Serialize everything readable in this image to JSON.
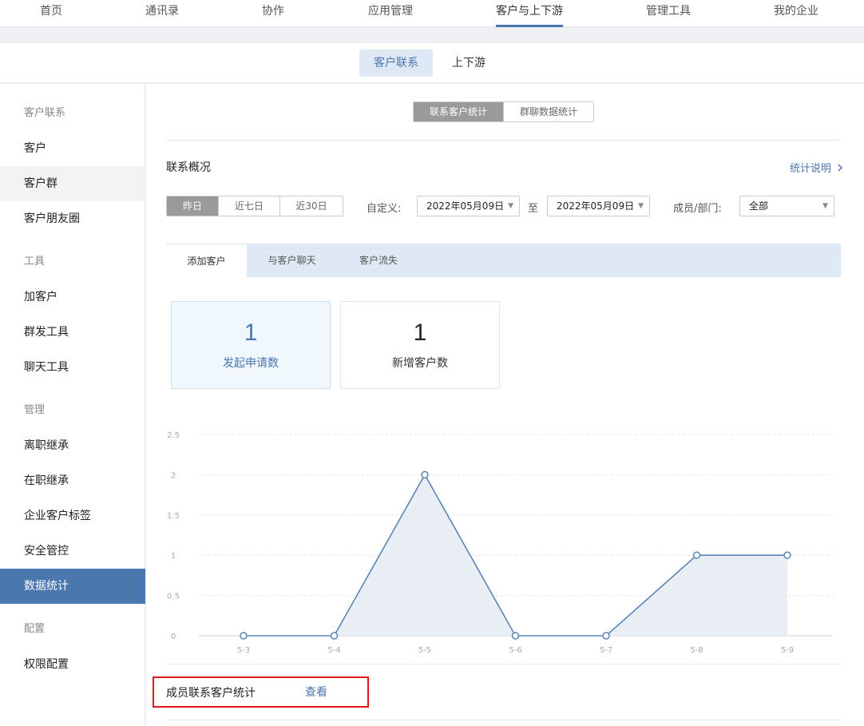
{
  "topnav": {
    "items": [
      "首页",
      "通讯录",
      "协作",
      "应用管理",
      "客户与上下游",
      "管理工具",
      "我的企业"
    ],
    "active_index": 4
  },
  "subnav": {
    "tabs": [
      "客户联系",
      "上下游"
    ],
    "active_index": 0
  },
  "sidebar": {
    "rows": [
      {
        "label": "客户联系",
        "kind": "section"
      },
      {
        "label": "客户",
        "kind": "item"
      },
      {
        "label": "客户群",
        "kind": "item",
        "state": "hover"
      },
      {
        "label": "客户朋友圈",
        "kind": "item"
      },
      {
        "label": "工具",
        "kind": "section"
      },
      {
        "label": "加客户",
        "kind": "item"
      },
      {
        "label": "群发工具",
        "kind": "item"
      },
      {
        "label": "聊天工具",
        "kind": "item"
      },
      {
        "label": "管理",
        "kind": "section"
      },
      {
        "label": "离职继承",
        "kind": "item"
      },
      {
        "label": "在职继承",
        "kind": "item"
      },
      {
        "label": "企业客户标签",
        "kind": "item"
      },
      {
        "label": "安全管控",
        "kind": "item"
      },
      {
        "label": "数据统计",
        "kind": "item",
        "state": "active"
      },
      {
        "label": "配置",
        "kind": "section"
      },
      {
        "label": "权限配置",
        "kind": "item"
      }
    ]
  },
  "stats_switch": {
    "options": [
      "联系客户统计",
      "群聊数据统计"
    ],
    "active_index": 0
  },
  "overview": {
    "title": "联系概况",
    "help_link": "统计说明"
  },
  "help_chevron_icon": "chevron-right-icon",
  "filters": {
    "range_options": [
      "昨日",
      "近七日",
      "近30日"
    ],
    "range_active_index": 0,
    "custom_label": "自定义:",
    "start_date": "2022年05月09日",
    "to_label": "至",
    "end_date": "2022年05月09日",
    "member_label": "成员/部门:",
    "member_value": "全部"
  },
  "metric_tabs": {
    "tabs": [
      "添加客户",
      "与客户聊天",
      "客户流失"
    ],
    "active_index": 0
  },
  "cards": [
    {
      "value": "1",
      "caption": "发起申请数",
      "active": true
    },
    {
      "value": "1",
      "caption": "新增客户数",
      "active": false
    }
  ],
  "chart_data": {
    "type": "area",
    "categories": [
      "5-3",
      "5-4",
      "5-5",
      "5-6",
      "5-7",
      "5-8",
      "5-9"
    ],
    "values": [
      0,
      0,
      2,
      0,
      0,
      1,
      1
    ],
    "yticks": [
      "0",
      "0.5",
      "1",
      "1.5",
      "2",
      "2.5"
    ],
    "ylim": [
      0,
      2.5
    ],
    "grid": true,
    "colors": {
      "line": "#5b85b8",
      "fill": "#e7ecf3",
      "grid": "#e3e5e8",
      "tick": "#aaaaaa"
    }
  },
  "footer": {
    "label": "成员联系客户统计",
    "link": "查看"
  },
  "colors": {
    "accent": "#4a77ad",
    "highlight_border": "#e0161c"
  }
}
